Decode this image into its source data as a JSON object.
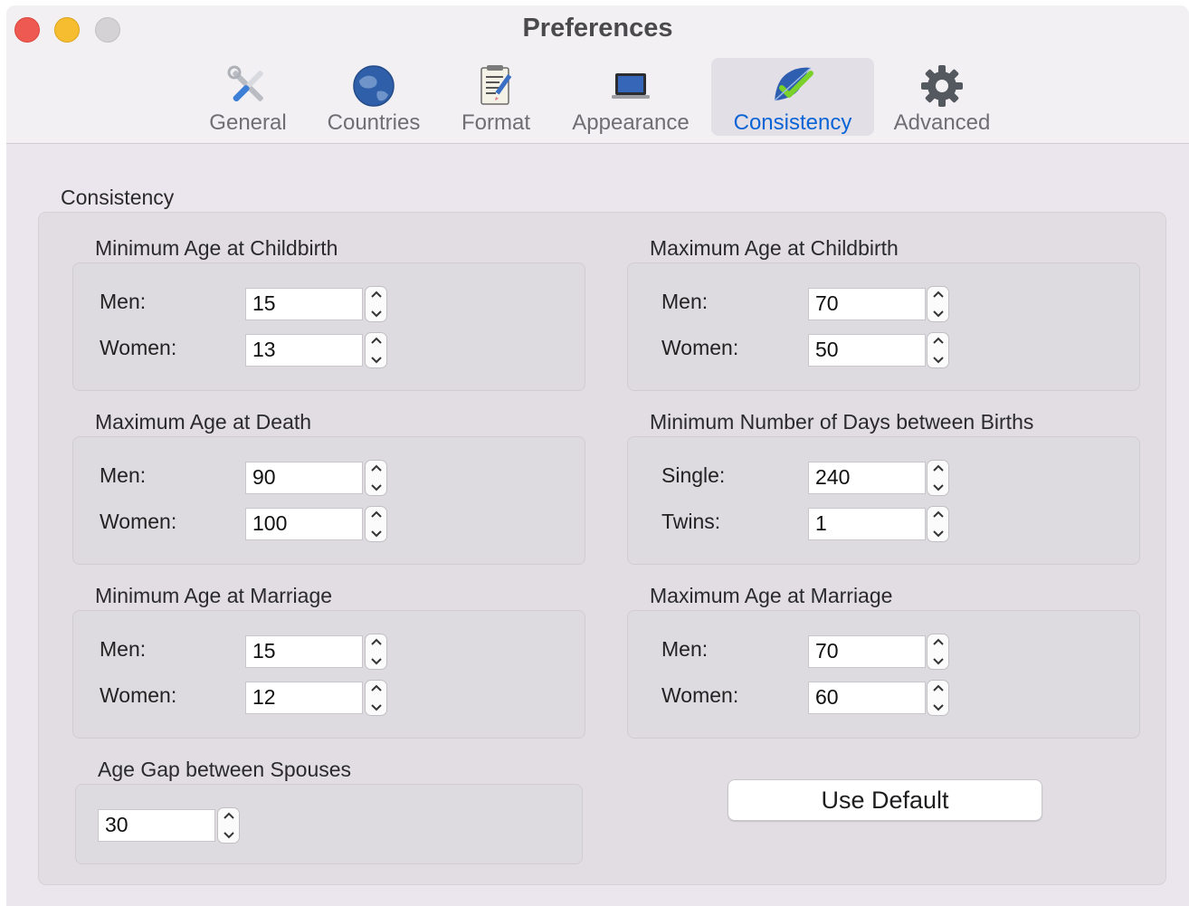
{
  "window": {
    "title": "Preferences"
  },
  "tabs": [
    {
      "label": "General",
      "icon": "tools-icon"
    },
    {
      "label": "Countries",
      "icon": "globe-icon"
    },
    {
      "label": "Format",
      "icon": "format-icon"
    },
    {
      "label": "Appearance",
      "icon": "laptop-icon"
    },
    {
      "label": "Consistency",
      "icon": "checkmark-icon",
      "active": true
    },
    {
      "label": "Advanced",
      "icon": "gear-icon"
    }
  ],
  "section_title": "Consistency",
  "groups": {
    "min_childbirth": {
      "title": "Minimum Age at Childbirth",
      "rows": [
        {
          "label": "Men:",
          "value": "15"
        },
        {
          "label": "Women:",
          "value": "13"
        }
      ]
    },
    "max_childbirth": {
      "title": "Maximum Age at Childbirth",
      "rows": [
        {
          "label": "Men:",
          "value": "70"
        },
        {
          "label": "Women:",
          "value": "50"
        }
      ]
    },
    "max_death": {
      "title": "Maximum Age at Death",
      "rows": [
        {
          "label": "Men:",
          "value": "90"
        },
        {
          "label": "Women:",
          "value": "100"
        }
      ]
    },
    "min_days_births": {
      "title": "Minimum Number of Days between Births",
      "rows": [
        {
          "label": "Single:",
          "value": "240"
        },
        {
          "label": "Twins:",
          "value": "1"
        }
      ]
    },
    "min_marriage": {
      "title": "Minimum Age at Marriage",
      "rows": [
        {
          "label": "Men:",
          "value": "15"
        },
        {
          "label": "Women:",
          "value": "12"
        }
      ]
    },
    "max_marriage": {
      "title": "Maximum Age at Marriage",
      "rows": [
        {
          "label": "Men:",
          "value": "70"
        },
        {
          "label": "Women:",
          "value": "60"
        }
      ]
    },
    "age_gap": {
      "title": "Age Gap between Spouses",
      "value": "30"
    }
  },
  "buttons": {
    "use_default": "Use Default"
  },
  "colors": {
    "accent": "#0a64d6",
    "close": "#ee5a52",
    "minimize": "#f5bd2f",
    "zoom": "#d4d2d5"
  }
}
